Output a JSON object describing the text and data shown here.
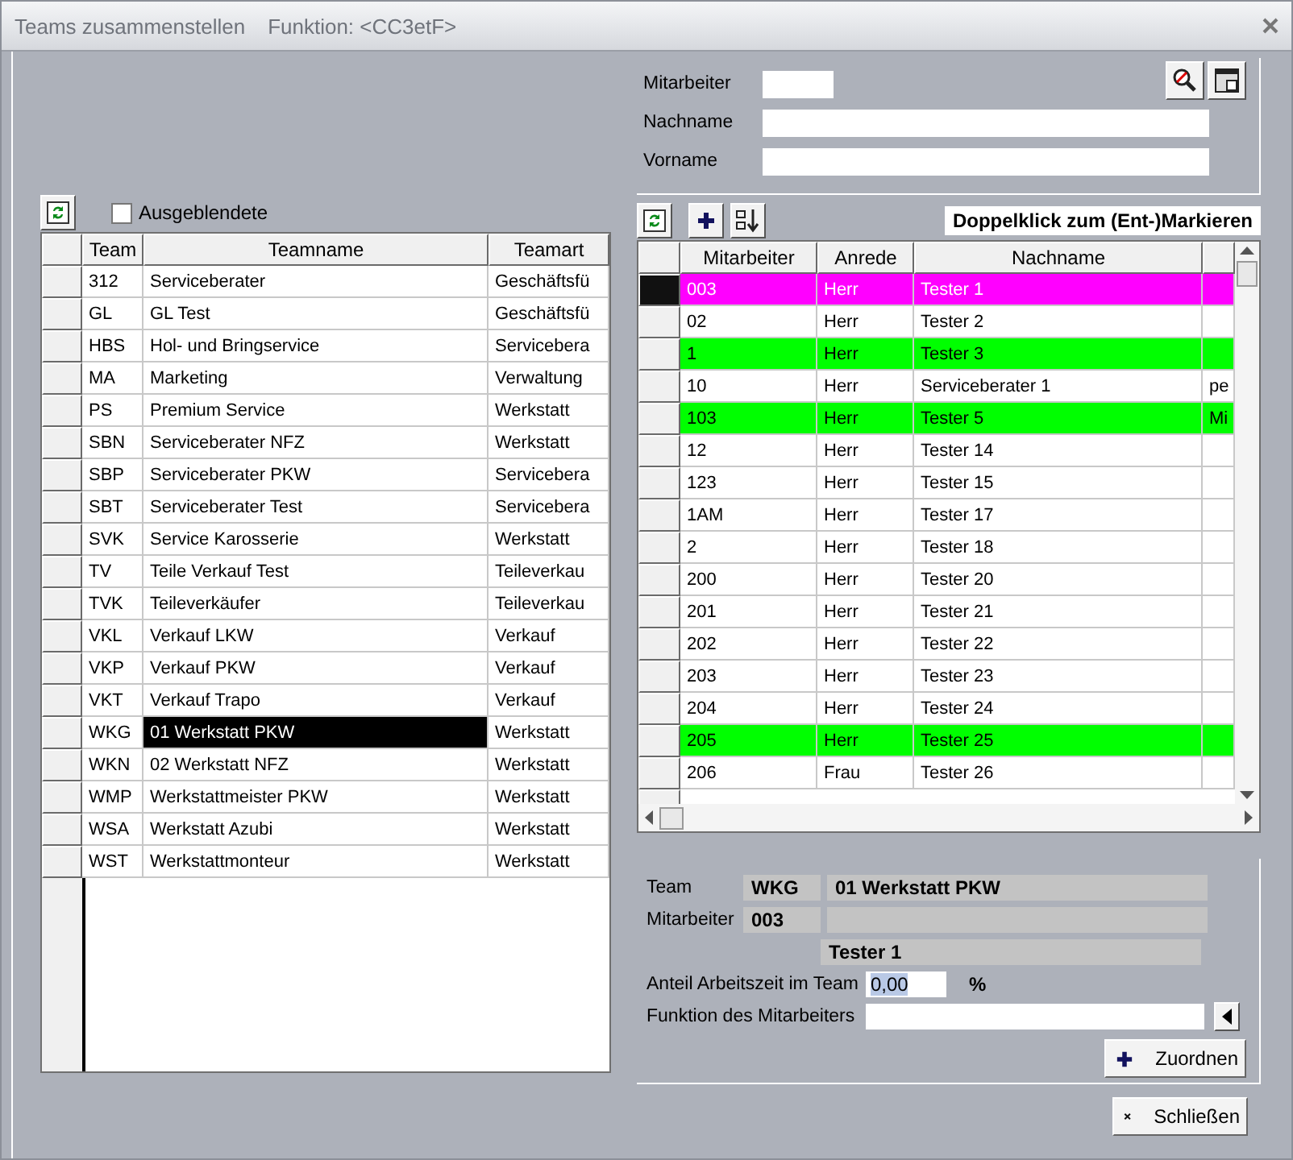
{
  "window": {
    "title": "Teams zusammenstellen",
    "subtitle": "Funktion: <CC3etF>"
  },
  "search": {
    "fields": [
      {
        "label": "Mitarbeiter",
        "kind": "short"
      },
      {
        "label": "Nachname",
        "kind": "long"
      },
      {
        "label": "Vorname",
        "kind": "long"
      }
    ]
  },
  "teams_toolbar": {
    "checkbox": {
      "label": "Ausgeblendete",
      "checked": false
    }
  },
  "teams": {
    "columns": [
      "Team",
      "Teamname",
      "Teamart"
    ],
    "rows": [
      {
        "cells": [
          "312",
          "Serviceberater",
          "Geschäftsfü"
        ],
        "selected": false
      },
      {
        "cells": [
          "GL",
          "GL Test",
          "Geschäftsfü"
        ],
        "selected": false
      },
      {
        "cells": [
          "HBS",
          "Hol- und Bringservice",
          "Servicebera"
        ],
        "selected": false
      },
      {
        "cells": [
          "MA",
          "Marketing",
          "Verwaltung"
        ],
        "selected": false
      },
      {
        "cells": [
          "PS",
          "Premium Service",
          "Werkstatt"
        ],
        "selected": false
      },
      {
        "cells": [
          "SBN",
          "Serviceberater NFZ",
          "Werkstatt"
        ],
        "selected": false
      },
      {
        "cells": [
          "SBP",
          "Serviceberater PKW",
          "Servicebera"
        ],
        "selected": false
      },
      {
        "cells": [
          "SBT",
          "Serviceberater Test",
          "Servicebera"
        ],
        "selected": false
      },
      {
        "cells": [
          "SVK",
          "Service Karosserie",
          "Werkstatt"
        ],
        "selected": false
      },
      {
        "cells": [
          "TV",
          "Teile Verkauf Test",
          "Teileverkau"
        ],
        "selected": false
      },
      {
        "cells": [
          "TVK",
          "Teileverkäufer",
          "Teileverkau"
        ],
        "selected": false
      },
      {
        "cells": [
          "VKL",
          "Verkauf LKW",
          "Verkauf"
        ],
        "selected": false
      },
      {
        "cells": [
          "VKP",
          "Verkauf PKW",
          "Verkauf"
        ],
        "selected": false
      },
      {
        "cells": [
          "VKT",
          "Verkauf Trapo",
          "Verkauf"
        ],
        "selected": false
      },
      {
        "cells": [
          "WKG",
          "01 Werkstatt PKW",
          "Werkstatt"
        ],
        "selected": true
      },
      {
        "cells": [
          "WKN",
          "02 Werkstatt NFZ",
          "Werkstatt"
        ],
        "selected": false
      },
      {
        "cells": [
          "WMP",
          "Werkstattmeister PKW",
          "Werkstatt"
        ],
        "selected": false
      },
      {
        "cells": [
          "WSA",
          "Werkstatt Azubi",
          "Werkstatt"
        ],
        "selected": false
      },
      {
        "cells": [
          "WST",
          "Werkstattmonteur",
          "Werkstatt"
        ],
        "selected": false
      }
    ]
  },
  "employees": {
    "hint": "Doppelklick zum (Ent-)Markieren",
    "columns": [
      "Mitarbeiter",
      "Anrede",
      "Nachname"
    ],
    "rows": [
      {
        "cells": [
          "003",
          "Herr",
          "Tester 1",
          ""
        ],
        "color": "#ff00ff",
        "selected": true
      },
      {
        "cells": [
          "02",
          "Herr",
          "Tester 2",
          ""
        ],
        "selected": false
      },
      {
        "cells": [
          "1",
          "Herr",
          "Tester 3",
          ""
        ],
        "color": "#00ff00",
        "selected": false
      },
      {
        "cells": [
          "10",
          "Herr",
          "Serviceberater 1",
          "pe"
        ],
        "selected": false
      },
      {
        "cells": [
          "103",
          "Herr",
          "Tester 5",
          "Mi"
        ],
        "color": "#00ff00",
        "selected": false
      },
      {
        "cells": [
          "12",
          "Herr",
          "Tester 14",
          ""
        ],
        "selected": false
      },
      {
        "cells": [
          "123",
          "Herr",
          "Tester 15",
          ""
        ],
        "selected": false
      },
      {
        "cells": [
          "1AM",
          "Herr",
          "Tester 17",
          ""
        ],
        "selected": false
      },
      {
        "cells": [
          "2",
          "Herr",
          "Tester 18",
          ""
        ],
        "selected": false
      },
      {
        "cells": [
          "200",
          "Herr",
          "Tester 20",
          ""
        ],
        "selected": false
      },
      {
        "cells": [
          "201",
          "Herr",
          "Tester 21",
          ""
        ],
        "selected": false
      },
      {
        "cells": [
          "202",
          "Herr",
          "Tester 22",
          ""
        ],
        "selected": false
      },
      {
        "cells": [
          "203",
          "Herr",
          "Tester 23",
          ""
        ],
        "selected": false
      },
      {
        "cells": [
          "204",
          "Herr",
          "Tester 24",
          ""
        ],
        "selected": false
      },
      {
        "cells": [
          "205",
          "Herr",
          "Tester 25",
          ""
        ],
        "color": "#00ff00",
        "selected": false
      },
      {
        "cells": [
          "206",
          "Frau",
          "Tester 26",
          ""
        ],
        "selected": false
      }
    ]
  },
  "details": {
    "team_label": "Team",
    "team_code": "WKG",
    "team_name": "01 Werkstatt PKW",
    "employee_label": "Mitarbeiter",
    "employee_code": "003",
    "employee_name": "Tester 1",
    "share_label": "Anteil Arbeitszeit im Team",
    "share_value": "0,00",
    "share_unit": "%",
    "function_label": "Funktion des Mitarbeiters",
    "assign_button": "Zuordnen"
  },
  "close_button": "Schließen"
}
